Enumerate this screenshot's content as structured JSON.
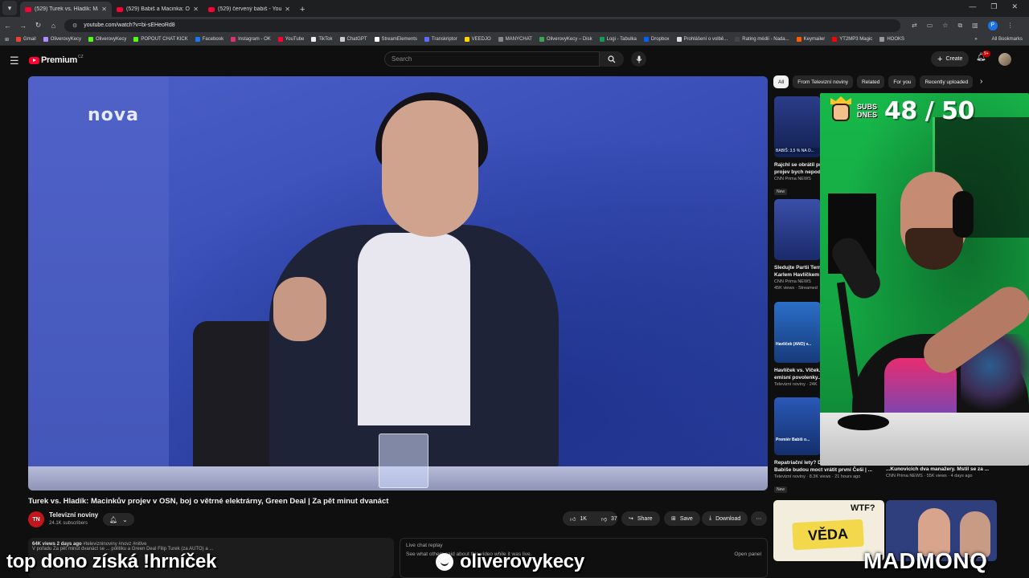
{
  "browser": {
    "tabs": [
      {
        "label": "(529) Turek vs. Hladík: Macinkův",
        "active": true
      },
      {
        "label": "(529) Babiš a Macinka: Opatřen",
        "active": false
      },
      {
        "label": "(529) červený babiš - YouTube",
        "active": false
      }
    ],
    "url": "youtube.com/watch?v=bi-sEHeoRd8",
    "profile_initial": "P",
    "bookmarks": [
      "Gmail",
      "OliverovyKecy",
      "OliverovyKecy",
      "POPOUT CHAT KICK",
      "Facebook",
      "Instagram - OK",
      "YouTube",
      "TikTok",
      "ChatGPT",
      "StreamElements",
      "Transkriptor",
      "VEEDJO",
      "MANYCHAT",
      "OliverovyKecy – Disk",
      "Logi - Tabulka",
      "Dropbox",
      "Prohlášení o volbě...",
      "Rating médií - Nada...",
      "Keymailer",
      "YT2MP3 Magic",
      "HOOKS"
    ],
    "all_bookmarks": "All Bookmarks"
  },
  "header": {
    "logo_text": "Premium",
    "logo_region": "CZ",
    "search_placeholder": "Search",
    "create_label": "Create",
    "notif_badge": "9+"
  },
  "player": {
    "channel_logo": "nova"
  },
  "video": {
    "title": "Turek vs. Hladík: Macinkův projev v OSN, boj o větrné elektrárny, Green Deal | Za pět minut dvanáct",
    "channel_initials": "TN",
    "channel_name": "Televizní noviny",
    "subscribers": "24.1K subscribers",
    "likes": "1K",
    "dislikes": "37",
    "share": "Share",
    "save": "Save",
    "download": "Download",
    "desc_stats": "64K views  2 days ago",
    "desc_tags": "#televizninoviny #novz #nitive",
    "desc_text": "V pořadu Za pět minut dvanáct se ... politiku a Green Deal Filip Turek (za AUTO) a ...",
    "livechat": "Live chat replay",
    "livechat_sub": "See what others said about this video while it was live.",
    "livechat_btn": "Open panel"
  },
  "chips": [
    "All",
    "From Televizní noviny",
    "Related",
    "For you",
    "Recently uploaded"
  ],
  "recommendations": [
    {
      "title": "Rajchl se obrátil pr...",
      "title2": "projev bych nepod...",
      "channel": "CNN Prima NEWS",
      "meta": "",
      "badge": "New",
      "thumb_text": "BABIŠ: 3,5 % NA O..."
    },
    {
      "title": "Sledujte Partii Terr...",
      "title2": "Karlem Havlíčkem",
      "channel": "CNN Prima NEWS",
      "meta": "45K views · Streamed",
      "badge": "",
      "thumb_text": ""
    },
    {
      "title": "Havlíček vs. Vlček...",
      "title2": "emisní povolenky...",
      "channel": "Televizní noviny · 24K",
      "meta": "",
      "badge": "",
      "thumb_text": "Havlíček (ANO) v..."
    },
    {
      "title": "Repatriační lety? Dohru se podle...",
      "title2": "Babiše budou moct vrátit první Češi | ...",
      "channel": "Televizní noviny · 8.3K views · 21 hours ago",
      "meta": "",
      "badge": "New",
      "thumb_text": "Premiér Babiš o..."
    },
    {
      "title": "...Kunovicích dva manažery. Mstil se za ...",
      "title2": "",
      "channel": "CNN Prima NEWS · 55K views · 4 days ago",
      "meta": "",
      "badge": "",
      "thumb_text": ""
    }
  ],
  "bottom_thumbs": {
    "one_text": "VĚDA",
    "one_wtf": "WTF?"
  },
  "overlay": {
    "sub_goal_label": "SUBS DNES",
    "sub_goal_count": "48 / 50",
    "bottom_left": "top dono získá !hrníček",
    "bottom_mid": "oliverovykecy",
    "bottom_right": "MADMONQ"
  },
  "colors": {
    "background": "#0f0f0f",
    "yt_red": "#ff0033",
    "chip_active": "#f1f1f1",
    "cam_green": "#17b84a"
  }
}
